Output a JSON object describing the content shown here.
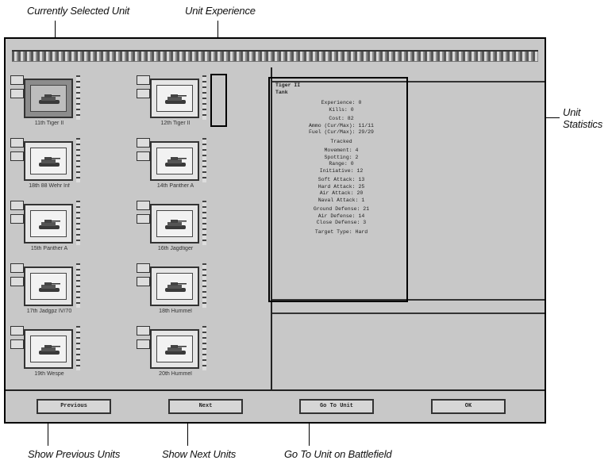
{
  "callouts": {
    "selected_unit": "Currently Selected Unit",
    "experience": "Unit Experience",
    "statistics_line1": "Unit",
    "statistics_line2": "Statistics",
    "prev_units": "Show Previous Units",
    "next_units": "Show Next Units",
    "goto_unit": "Go To Unit on Battlefield"
  },
  "units": [
    {
      "label": "11th Tiger II",
      "selected": true
    },
    {
      "label": "12th Tiger II",
      "selected": false
    },
    {
      "label": "18th 88 Wehr Inf",
      "selected": false
    },
    {
      "label": "14th Panther A",
      "selected": false
    },
    {
      "label": "15th Panther A",
      "selected": false
    },
    {
      "label": "16th Jagdtiger",
      "selected": false
    },
    {
      "label": "17th Jadgpz IV/70",
      "selected": false
    },
    {
      "label": "18th Hummel",
      "selected": false
    },
    {
      "label": "19th Wespe",
      "selected": false
    },
    {
      "label": "20th Hummel",
      "selected": false
    }
  ],
  "stats": {
    "name": "Tiger II",
    "class": "Tank",
    "rows": [
      "Experience: 0",
      "Kills: 0",
      "Cost: 82",
      "Ammo (Cur/Max): 11/11",
      "Fuel (Cur/Max): 29/29",
      "Tracked",
      "Movement: 4",
      "Spotting: 2",
      "Range: 0",
      "Initiative: 12",
      "Soft Attack: 13",
      "Hard Attack: 25",
      "Air Attack: 20",
      "Naval Attack: 1",
      "Ground Defense: 21",
      "Air Defense: 14",
      "Close Defense: 3",
      "Target Type: Hard"
    ]
  },
  "buttons": {
    "previous": "Previous",
    "next": "Next",
    "goto": "Go To Unit",
    "ok": "OK"
  }
}
